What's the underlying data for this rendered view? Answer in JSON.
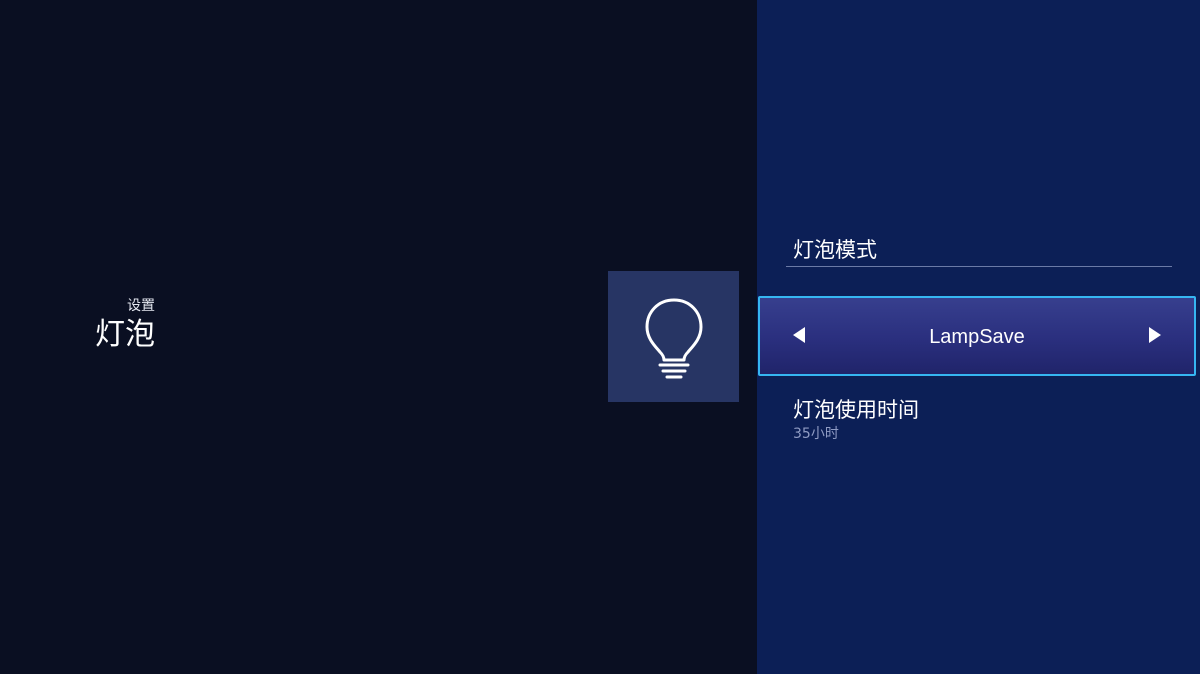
{
  "breadcrumb": {
    "parent": "设置",
    "title": "灯泡"
  },
  "category": {
    "icon": "lightbulb-icon"
  },
  "lamp_mode": {
    "label": "灯泡模式",
    "value": "LampSave"
  },
  "lamp_usage": {
    "label": "灯泡使用时间",
    "value": "35小时"
  },
  "colors": {
    "left_background": "#0a0f22",
    "right_background": "#0c1f56",
    "tile_background": "#273564",
    "focus_border": "#36b6f2",
    "selector_fill": "#2a2f7e",
    "secondary_text": "#8f9bc3"
  }
}
